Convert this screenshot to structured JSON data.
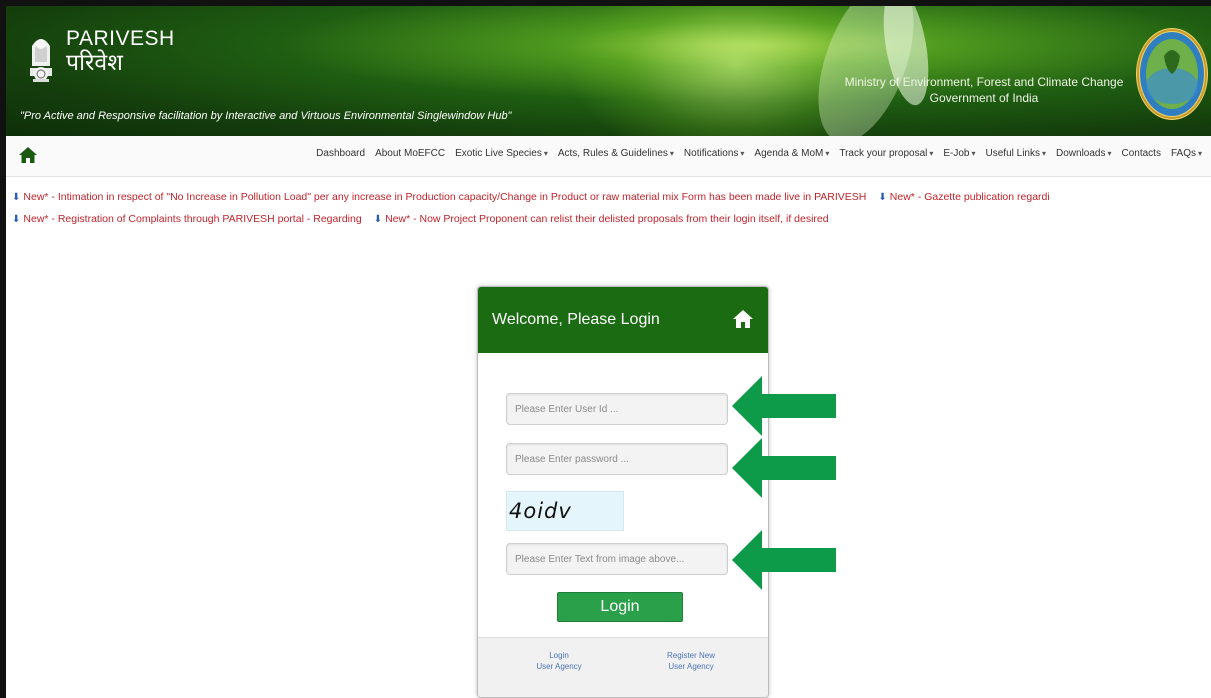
{
  "header": {
    "brand_name": "PARIVESH",
    "brand_hindi": "परिवेश",
    "tagline": "\"Pro Active and Responsive facilitation by Interactive and Virtuous Environmental Singlewindow Hub\"",
    "ministry_line1": "Ministry of Environment, Forest and Climate Change",
    "ministry_line2": "Government of India"
  },
  "navbar": {
    "items": [
      {
        "label": "Dashboard",
        "dropdown": false
      },
      {
        "label": "About MoEFCC",
        "dropdown": false
      },
      {
        "label": "Exotic Live Species",
        "dropdown": true
      },
      {
        "label": "Acts, Rules & Guidelines",
        "dropdown": true
      },
      {
        "label": "Notifications",
        "dropdown": true
      },
      {
        "label": "Agenda & MoM",
        "dropdown": true
      },
      {
        "label": "Track your proposal",
        "dropdown": true
      },
      {
        "label": "E-Job",
        "dropdown": true
      },
      {
        "label": "Useful Links",
        "dropdown": true
      },
      {
        "label": "Downloads",
        "dropdown": true
      },
      {
        "label": "Contacts",
        "dropdown": false
      },
      {
        "label": "FAQs",
        "dropdown": true
      }
    ]
  },
  "ticker": {
    "line1_a": "New* - Intimation in respect of \"No Increase in Pollution Load\" per any increase in Production capacity/Change in Product or raw material mix Form has been made live in PARIVESH",
    "line1_b": "New* - Gazette publication regardi",
    "line2_a": "New* - Registration of Complaints through PARIVESH portal - Regarding",
    "line2_b": "New* - Now Project Proponent can relist their delisted proposals from their login itself, if desired"
  },
  "login": {
    "title": "Welcome, Please Login",
    "userid_placeholder": "Please Enter User Id ...",
    "password_placeholder": "Please Enter password ...",
    "captcha_text": "4oidv",
    "captcha_placeholder": "Please Enter Text from image above...",
    "login_button": "Login",
    "footer_link1_line1": "Login",
    "footer_link1_line2": "User Agency",
    "footer_link2_line1": "Register New",
    "footer_link2_line2": "User Agency"
  },
  "colors": {
    "header_green": "#1f5e12",
    "card_header": "#1b6b13",
    "login_button": "#2aa04a",
    "ticker_text": "#c0242c",
    "arrow": "#0e9b49"
  }
}
